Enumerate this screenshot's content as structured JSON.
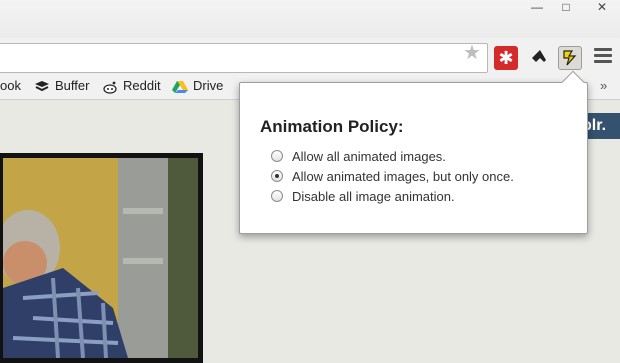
{
  "window_controls": {
    "minimize": "—",
    "maximize": "□",
    "close": "✕"
  },
  "toolbar": {
    "star_icon": "star-icon",
    "extensions": [
      {
        "name": "lastpass-icon",
        "glyph": "✱",
        "color": "#d52a2a"
      },
      {
        "name": "feedly-icon",
        "glyph": "",
        "color": "#333333"
      },
      {
        "name": "animation-policy-icon",
        "glyph": "",
        "color": "#f2d500"
      }
    ],
    "menu_icon": "menu-icon"
  },
  "bookmarks": [
    {
      "label": "ook",
      "icon": "facebook-icon"
    },
    {
      "label": "Buffer",
      "icon": "buffer-icon"
    },
    {
      "label": "Reddit",
      "icon": "reddit-icon"
    },
    {
      "label": "Drive",
      "icon": "drive-icon"
    }
  ],
  "page": {
    "tumblr_logo": "blr."
  },
  "popup": {
    "title": "Animation Policy:",
    "options": [
      {
        "label": "Allow all animated images.",
        "checked": false
      },
      {
        "label": "Allow animated images, but only once.",
        "checked": true
      },
      {
        "label": "Disable all image animation.",
        "checked": false
      }
    ]
  },
  "overflow_label": "»"
}
